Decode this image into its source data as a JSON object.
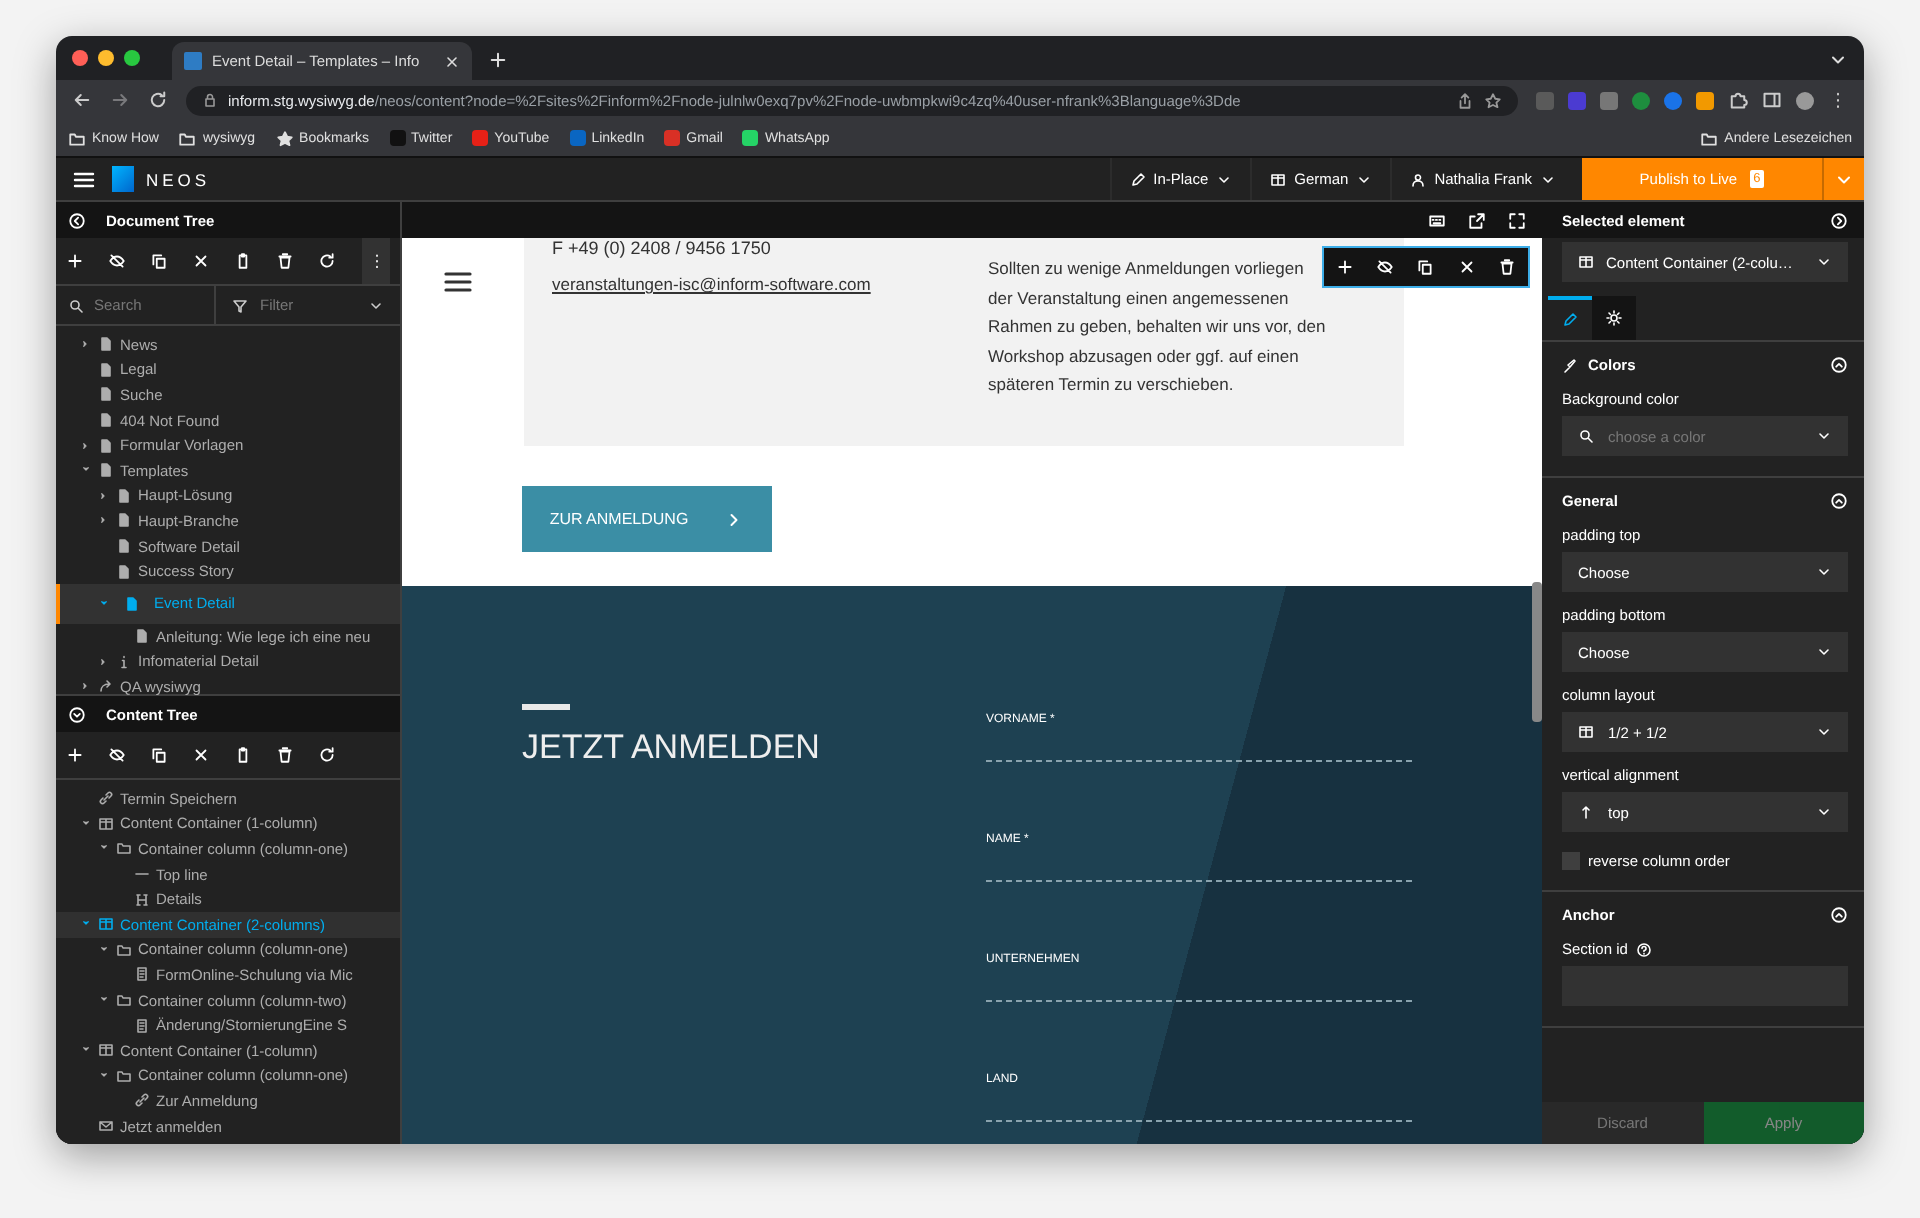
{
  "browser": {
    "tab_title": "Event Detail – Templates – Info",
    "url": {
      "host": "inform.stg.wysiwyg.de",
      "path": "/neos/content?node=%2Fsites%2Finform%2Fnode-julnlw0exq7pv%2Fnode-uwbmpkwi9c4zq%40user-nfrank%3Blanguage%3Dde"
    },
    "bookmarks": [
      {
        "label": "Know How",
        "kind": "folder"
      },
      {
        "label": "wysiwyg",
        "kind": "folder"
      },
      {
        "label": "Bookmarks",
        "kind": "star"
      },
      {
        "label": "Twitter",
        "kind": "x"
      },
      {
        "label": "YouTube",
        "kind": "video"
      },
      {
        "label": "LinkedIn",
        "kind": "network"
      },
      {
        "label": "Gmail",
        "kind": "mail"
      },
      {
        "label": "WhatsApp",
        "kind": "chat"
      }
    ],
    "other_bookmarks": "Andere Lesezeichen"
  },
  "neos": {
    "brand": "NEOS",
    "edit_mode": "In-Place",
    "language": "German",
    "user": "Nathalia Frank",
    "publish": {
      "label": "Publish to Live",
      "count": "6"
    }
  },
  "document_tree": {
    "title": "Document Tree",
    "search_placeholder": "Search",
    "filter_placeholder": "Filter",
    "items": [
      {
        "label": "News",
        "kind": "page",
        "expanded": false,
        "selected": false
      },
      {
        "label": "Legal",
        "kind": "page",
        "selected": false
      },
      {
        "label": "Suche",
        "kind": "page",
        "selected": false
      },
      {
        "label": "404 Not Found",
        "kind": "page",
        "selected": false
      },
      {
        "label": "Formular Vorlagen",
        "kind": "page",
        "expanded": false,
        "selected": false
      },
      {
        "label": "Templates",
        "kind": "page",
        "expanded": true,
        "selected": false,
        "children": [
          {
            "label": "Haupt-Lösung",
            "kind": "page",
            "expanded": false,
            "selected": false
          },
          {
            "label": "Haupt-Branche",
            "kind": "page",
            "expanded": false,
            "selected": false
          },
          {
            "label": "Software Detail",
            "kind": "page",
            "selected": false
          },
          {
            "label": "Success Story",
            "kind": "page",
            "selected": false
          },
          {
            "label": "Event Detail",
            "kind": "page",
            "expanded": true,
            "selected": true,
            "children": [
              {
                "label": "Anleitung: Wie lege ich eine neu",
                "kind": "page",
                "selected": false
              }
            ]
          },
          {
            "label": "Infomaterial Detail",
            "kind": "info",
            "expanded": false,
            "selected": false
          }
        ]
      },
      {
        "label": "QA wysiwyg",
        "kind": "shortcut",
        "expanded": false,
        "selected": false
      }
    ]
  },
  "content_tree": {
    "title": "Content Tree",
    "items": [
      {
        "label": "Termin Speichern",
        "kind": "link",
        "selected": false
      },
      {
        "label": "Content Container (1-column)",
        "kind": "container",
        "expanded": true,
        "selected": false,
        "children": [
          {
            "label": "Container column (column-one)",
            "kind": "column",
            "expanded": true,
            "selected": false,
            "children": [
              {
                "label": "Top line",
                "kind": "line",
                "selected": false
              },
              {
                "label": "Details",
                "kind": "headline",
                "selected": false
              }
            ]
          }
        ]
      },
      {
        "label": "Content Container (2-columns)",
        "kind": "container",
        "expanded": true,
        "selected": true,
        "children": [
          {
            "label": "Container column (column-one)",
            "kind": "column",
            "expanded": true,
            "selected": false,
            "children": [
              {
                "label": "FormOnline-Schulung via Mic",
                "kind": "text",
                "selected": false
              }
            ]
          },
          {
            "label": "Container column (column-two)",
            "kind": "column",
            "expanded": true,
            "selected": false,
            "children": [
              {
                "label": "Änderung/StornierungEine S",
                "kind": "text",
                "selected": false
              }
            ]
          }
        ]
      },
      {
        "label": "Content Container (1-column)",
        "kind": "container",
        "expanded": true,
        "selected": false,
        "children": [
          {
            "label": "Container column (column-one)",
            "kind": "column",
            "expanded": true,
            "selected": false,
            "children": [
              {
                "label": "Zur Anmeldung",
                "kind": "link",
                "selected": false
              }
            ]
          }
        ]
      },
      {
        "label": "Jetzt anmelden",
        "kind": "form",
        "selected": false
      }
    ]
  },
  "page": {
    "phone": "F +49 (0) 2408 / 9456 1750",
    "email": "veranstaltungen-isc@inform-software.com",
    "notice": "Sollten zu wenige Anmeldungen vorliegen der Veranstaltung einen angemessenen Rahmen zu geben, behalten wir uns vor, den Workshop abzusagen oder ggf. auf einen späteren Termin zu verschieben.",
    "button": "ZUR ANMELDUNG",
    "form_title": "JETZT ANMELDEN",
    "form_fields": [
      "VORNAME *",
      "NAME *",
      "UNTERNEHMEN",
      "LAND"
    ]
  },
  "inspector": {
    "title": "Selected element",
    "element": "Content Container (2-colu…",
    "tabs": [
      {
        "kind": "content",
        "selected": true
      },
      {
        "kind": "settings",
        "selected": false
      }
    ],
    "sections": [
      {
        "title": "Colors",
        "kind": "colors",
        "expanded": true,
        "fields": [
          {
            "label": "Background color",
            "kind": "color",
            "placeholder": "choose a color"
          }
        ]
      },
      {
        "title": "General",
        "kind": "general",
        "expanded": true,
        "fields": [
          {
            "label": "padding top",
            "kind": "select",
            "value": "Choose"
          },
          {
            "label": "padding bottom",
            "kind": "select",
            "value": "Choose"
          },
          {
            "label": "column layout",
            "kind": "layout",
            "value": "1/2 + 1/2"
          },
          {
            "label": "vertical alignment",
            "kind": "alignment",
            "value": "top"
          },
          {
            "label": "reverse column order",
            "kind": "checkbox",
            "checked": false
          }
        ]
      },
      {
        "title": "Anchor",
        "kind": "anchor",
        "expanded": true,
        "fields": [
          {
            "label": "Section id",
            "kind": "text",
            "help": true
          }
        ]
      }
    ],
    "actions": [
      {
        "label": "Discard",
        "kind": "discard",
        "disabled": true
      },
      {
        "label": "Apply",
        "kind": "apply",
        "disabled": true
      }
    ]
  }
}
